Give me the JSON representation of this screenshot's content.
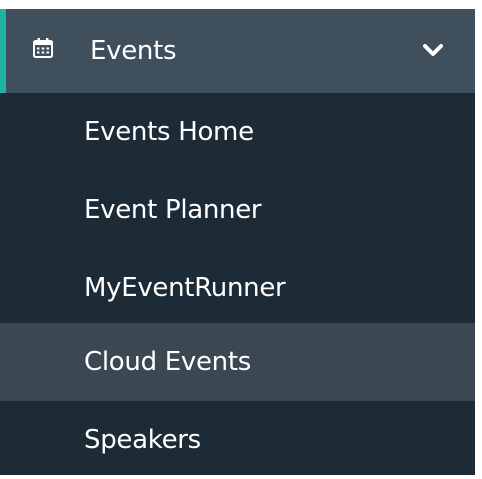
{
  "menu": {
    "header": {
      "label": "Events",
      "icon": "calendar-icon",
      "toggle_icon": "chevron-down-icon"
    },
    "items": [
      {
        "label": "Events Home"
      },
      {
        "label": "Event Planner"
      },
      {
        "label": "MyEventRunner"
      },
      {
        "label": "Cloud Events",
        "active": true
      },
      {
        "label": "Speakers"
      }
    ]
  },
  "colors": {
    "menu_background": "#1c2b35",
    "header_background": "#3f4f5c",
    "active_item_background": "#3b4853",
    "accent": "#20b3a3",
    "text": "#ffffff"
  }
}
